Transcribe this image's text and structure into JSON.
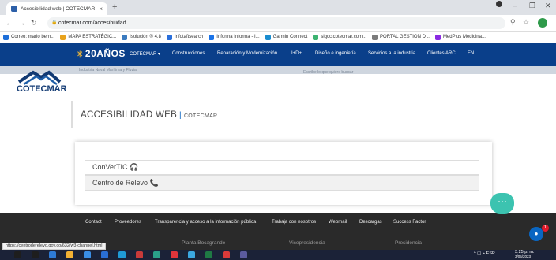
{
  "browser": {
    "tab_title": "Accesibilidad web | COTECMAR",
    "tab_close": "×",
    "new_tab": "+",
    "window": {
      "minimize": "–",
      "restore": "❐",
      "close": "✕"
    },
    "url": "cotecmar.com/accesibilidad",
    "bookmarks": [
      {
        "label": "Correo: mario bern...",
        "color": "#1e6fd9"
      },
      {
        "label": "MAPA ESTRATÉGIC...",
        "color": "#e8a21c"
      },
      {
        "label": "Isolución ® 4.8",
        "color": "#3b7bbf"
      },
      {
        "label": "Infotaftsearch",
        "color": "#2a6fdb"
      },
      {
        "label": "Informa Informa - I...",
        "color": "#1a73e8"
      },
      {
        "label": "Garmin Connect",
        "color": "#1a8ccf"
      },
      {
        "label": "sigcc.cotecmar.com...",
        "color": "#3cb371"
      },
      {
        "label": "PORTAL GESTION D...",
        "color": "#7b7b7b"
      },
      {
        "label": "MedPlus Medicina...",
        "color": "#8a2be2"
      }
    ]
  },
  "site": {
    "logo_text": "20AÑOS",
    "nav": [
      "COTECMAR ▾",
      "Construcciones",
      "Reparación y Modernización",
      "I+D+i",
      "Diseño e ingeniería",
      "Servicios a la industria",
      "Clientes ARC",
      "EN"
    ],
    "sub_left": "Industria Naval Marítima y Fluvial",
    "search_placeholder": "Escribe lo que quiere buscar",
    "brand": "COTECMAR",
    "page_title": "ACCESIBILIDAD WEB",
    "title_sep": "|",
    "page_title_small": "COTECMAR",
    "rows": [
      "ConVerTIC 🎧",
      "Centro de Relevo 📞"
    ],
    "footer_links": [
      "Contact",
      "Proveedores",
      "Transparencia y acceso a la información pública",
      "Trabaja con nosotros",
      "Webmail",
      "Descargas",
      "Success Factor"
    ],
    "footer_second": [
      "Planta Bocagrande",
      "Vicepresidencia",
      "Presidencia"
    ],
    "chat_label": "···",
    "messenger_badge": "1"
  },
  "status_url": "https://centroderelevo.gov.co/632/w3-channel.html",
  "taskbar": {
    "icons": [
      "#1e1e1e",
      "#1e1e1e",
      "#2e7bd6",
      "#f2b134",
      "#3a8ee6",
      "#2a6fd4",
      "#1f9ad6",
      "#c73a3a",
      "#2aa08a",
      "#e0353b",
      "#3ba7e2",
      "#1f7a44",
      "#d93a3a",
      "#5b5b9e"
    ],
    "tray": "^ ◫ ⌁ ESP",
    "time": "3:25 p. m.",
    "date": "3/05/2023"
  }
}
